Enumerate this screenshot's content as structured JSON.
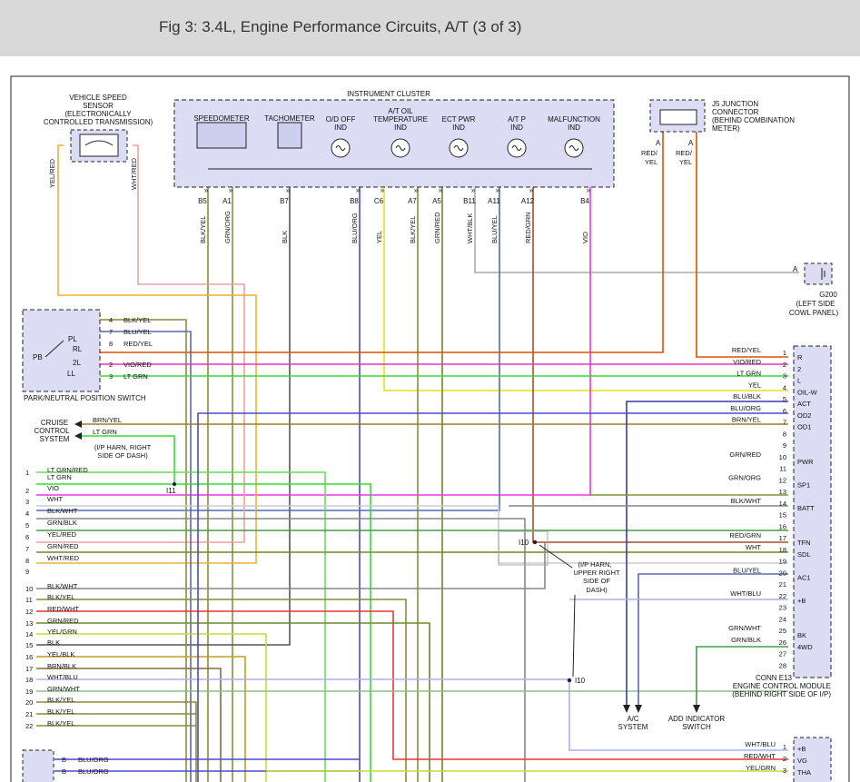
{
  "header": {
    "title": "Fig 3: 3.4L, Engine Performance Circuits, A/T (3 of 3)"
  },
  "instrument_cluster": {
    "title": "INSTRUMENT CLUSTER",
    "speedometer": "SPEEDOMETER",
    "tachometer": "TACHOMETER",
    "indicators": [
      {
        "lines": [
          "O/D OFF",
          "IND"
        ]
      },
      {
        "lines": [
          "A/T OIL",
          "TEMPERATURE",
          "IND"
        ]
      },
      {
        "lines": [
          "ECT PWR",
          "IND"
        ]
      },
      {
        "lines": [
          "A/T P",
          "IND"
        ]
      },
      {
        "lines": [
          "MALFUNCTION",
          "IND"
        ]
      }
    ],
    "pins": [
      "B5",
      "A1",
      "B7",
      "B8",
      "C6",
      "A7",
      "A5",
      "B11",
      "A11",
      "A12",
      "B4"
    ],
    "wires": [
      "BLK/YEL",
      "GRN/ORG",
      "BLK",
      "BLU/ORG",
      "YEL",
      "BLK/YEL",
      "GRN/RED",
      "WHT/BLK",
      "BLU/YEL",
      "RED/GRN",
      "VIO"
    ]
  },
  "vss": {
    "label_lines": [
      "VEHICLE SPEED",
      "SENSOR",
      "(ELECTRONICALLY",
      "CONTROLLED TRANSMISSION)"
    ],
    "wire_left": "YEL/RED",
    "wire_right": "WHT/RED"
  },
  "j5": {
    "label_lines": [
      "J5 JUNCTION",
      "CONNECTOR",
      "(BEHIND COMBINATION",
      "METER)"
    ],
    "pin_a": "A",
    "wire_lines": [
      "RED/",
      "YEL"
    ]
  },
  "g200": {
    "pin": "A",
    "label_lines": [
      "G200",
      "(LEFT SIDE",
      "COWL PANEL)"
    ]
  },
  "pn_switch": {
    "label": "PARK/NEUTRAL POSITION SWITCH",
    "pb": "PB",
    "positions": [
      "PL",
      "RL",
      "2L",
      "LL"
    ],
    "pins": [
      {
        "num": "4",
        "wire": "BLK/YEL"
      },
      {
        "num": "7",
        "wire": "BLU/YEL"
      },
      {
        "num": "8",
        "wire": "RED/YEL"
      },
      {
        "num": "2",
        "wire": "VIO/RED"
      },
      {
        "num": "3",
        "wire": "LT GRN"
      }
    ]
  },
  "cruise": {
    "label_lines": [
      "CRUISE",
      "CONTROL",
      "SYSTEM"
    ],
    "wires": [
      "BRN/YEL",
      "LT GRN"
    ]
  },
  "i11": {
    "note_lines": [
      "(I/P HARN, RIGHT",
      "SIDE OF DASH)"
    ],
    "label": "I11"
  },
  "i10": {
    "label": "I10",
    "label2": "I10",
    "note_lines": [
      "(I/P HARN,",
      "UPPER RIGHT",
      "SIDE OF",
      "DASH)"
    ]
  },
  "left_connector": {
    "rows": [
      {
        "num": "1",
        "wire": "LT GRN/RED"
      },
      {
        "num": "",
        "wire": "LT GRN"
      },
      {
        "num": "2",
        "wire": "VIO"
      },
      {
        "num": "3",
        "wire": "WHT"
      },
      {
        "num": "4",
        "wire": "BLK/WHT"
      },
      {
        "num": "5",
        "wire": "GRN/BLK"
      },
      {
        "num": "6",
        "wire": "YEL/RED"
      },
      {
        "num": "7",
        "wire": "GRN/RED"
      },
      {
        "num": "8",
        "wire": "WHT/RED"
      },
      {
        "num": "9",
        "wire": ""
      },
      {
        "num": "10",
        "wire": "BLK/WHT"
      },
      {
        "num": "11",
        "wire": "BLK/YEL"
      },
      {
        "num": "12",
        "wire": "RED/WHT"
      },
      {
        "num": "13",
        "wire": "GRN/RED"
      },
      {
        "num": "14",
        "wire": "YEL/GRN"
      },
      {
        "num": "15",
        "wire": "BLK"
      },
      {
        "num": "16",
        "wire": "YEL/BLK"
      },
      {
        "num": "17",
        "wire": "BRN/BLK"
      },
      {
        "num": "18",
        "wire": "WHT/BLU"
      },
      {
        "num": "19",
        "wire": "GRN/WHT"
      },
      {
        "num": "20",
        "wire": "BLK/YEL"
      },
      {
        "num": "21",
        "wire": "BLK/YEL"
      },
      {
        "num": "22",
        "wire": "BLK/YEL"
      }
    ]
  },
  "ecm": {
    "pins": [
      {
        "num": "1",
        "wire": "RED/YEL",
        "name": "R"
      },
      {
        "num": "2",
        "wire": "VIO/RED",
        "name": "2"
      },
      {
        "num": "3",
        "wire": "LT GRN",
        "name": "L"
      },
      {
        "num": "4",
        "wire": "YEL",
        "name": "OIL-W"
      },
      {
        "num": "5",
        "wire": "BLU/BLK",
        "name": "ACT"
      },
      {
        "num": "6",
        "wire": "BLU/ORG",
        "name": "OD2"
      },
      {
        "num": "7",
        "wire": "BRN/YEL",
        "name": "OD1"
      },
      {
        "num": "8",
        "wire": "",
        "name": ""
      },
      {
        "num": "9",
        "wire": "",
        "name": ""
      },
      {
        "num": "10",
        "wire": "GRN/RED",
        "name": "PWR"
      },
      {
        "num": "11",
        "wire": "",
        "name": ""
      },
      {
        "num": "12",
        "wire": "GRN/ORG",
        "name": "SP1"
      },
      {
        "num": "13",
        "wire": "",
        "name": ""
      },
      {
        "num": "14",
        "wire": "BLK/WHT",
        "name": "BATT"
      },
      {
        "num": "15",
        "wire": "",
        "name": ""
      },
      {
        "num": "16",
        "wire": "",
        "name": ""
      },
      {
        "num": "17",
        "wire": "RED/GRN",
        "name": "TFN"
      },
      {
        "num": "18",
        "wire": "WHT",
        "name": "SDL"
      },
      {
        "num": "19",
        "wire": "",
        "name": ""
      },
      {
        "num": "20",
        "wire": "BLU/YEL",
        "name": "AC1"
      },
      {
        "num": "21",
        "wire": "",
        "name": ""
      },
      {
        "num": "22",
        "wire": "WHT/BLU",
        "name": "+B"
      },
      {
        "num": "23",
        "wire": "",
        "name": ""
      },
      {
        "num": "24",
        "wire": "",
        "name": ""
      },
      {
        "num": "25",
        "wire": "GRN/WHT",
        "name": "BK"
      },
      {
        "num": "26",
        "wire": "GRN/BLK",
        "name": "4WD"
      },
      {
        "num": "27",
        "wire": "",
        "name": ""
      },
      {
        "num": "28",
        "wire": "",
        "name": ""
      }
    ],
    "label_lines": [
      "CONN E13",
      "ENGINE CONTROL MODULE",
      "(BEHIND RIGHT SIDE OF I/P)"
    ]
  },
  "ac_system": {
    "label_lines": [
      "A/C",
      "SYSTEM"
    ]
  },
  "add_indicator": {
    "label_lines": [
      "ADD INDICATOR",
      "SWITCH"
    ]
  },
  "bottom_left": {
    "rows": [
      {
        "pin": "B",
        "wire": "BLU/ORG"
      },
      {
        "pin": "B",
        "wire": "BLU/ORG"
      }
    ]
  },
  "bottom_right": {
    "rows": [
      {
        "num": "1",
        "wire": "WHT/BLU",
        "name": "+B"
      },
      {
        "num": "2",
        "wire": "RED/WHT",
        "name": "VG"
      },
      {
        "num": "3",
        "wire": "YEL/GRN",
        "name": "THA"
      }
    ]
  }
}
